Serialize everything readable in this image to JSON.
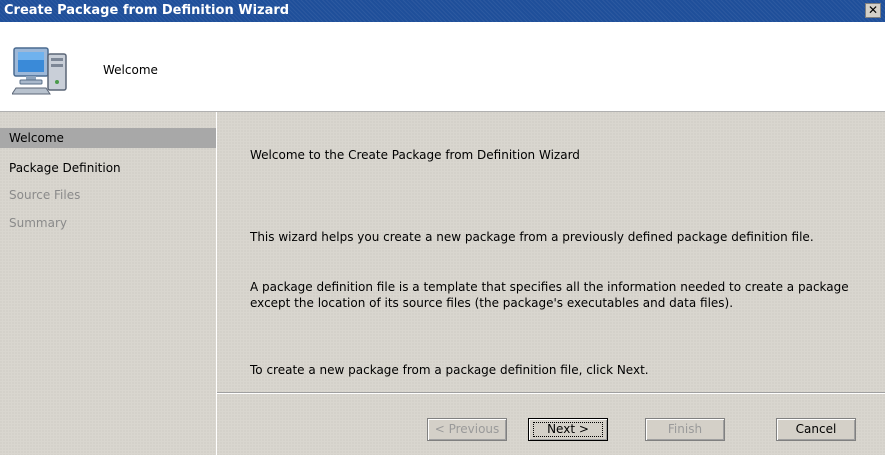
{
  "window": {
    "title": "Create Package from Definition Wizard",
    "close_glyph": "✕"
  },
  "header": {
    "title": "Welcome",
    "icon": "computer-icon"
  },
  "nav": {
    "items": [
      {
        "label": "Welcome",
        "state": "active"
      },
      {
        "label": "Package Definition",
        "state": "current"
      },
      {
        "label": "Source Files",
        "state": "disabled"
      },
      {
        "label": "Summary",
        "state": "disabled"
      }
    ]
  },
  "main": {
    "heading": "Welcome to the Create Package from Definition Wizard",
    "paragraph1": "This wizard helps you create a new package from a previously defined package definition file.",
    "paragraph2_line1": "A package definition file is a template that specifies all the information needed to create a package",
    "paragraph2_line2": "except the location of its source files (the package's executables and data files).",
    "paragraph3": "To create a new package from a package definition file, click Next."
  },
  "buttons": {
    "previous": "< Previous",
    "next": "Next >",
    "finish": "Finish",
    "cancel": "Cancel"
  },
  "colors": {
    "titlebar": "#1f4f9a",
    "pane": "#d9d6cf",
    "nav_active": "#a8a8a8"
  }
}
